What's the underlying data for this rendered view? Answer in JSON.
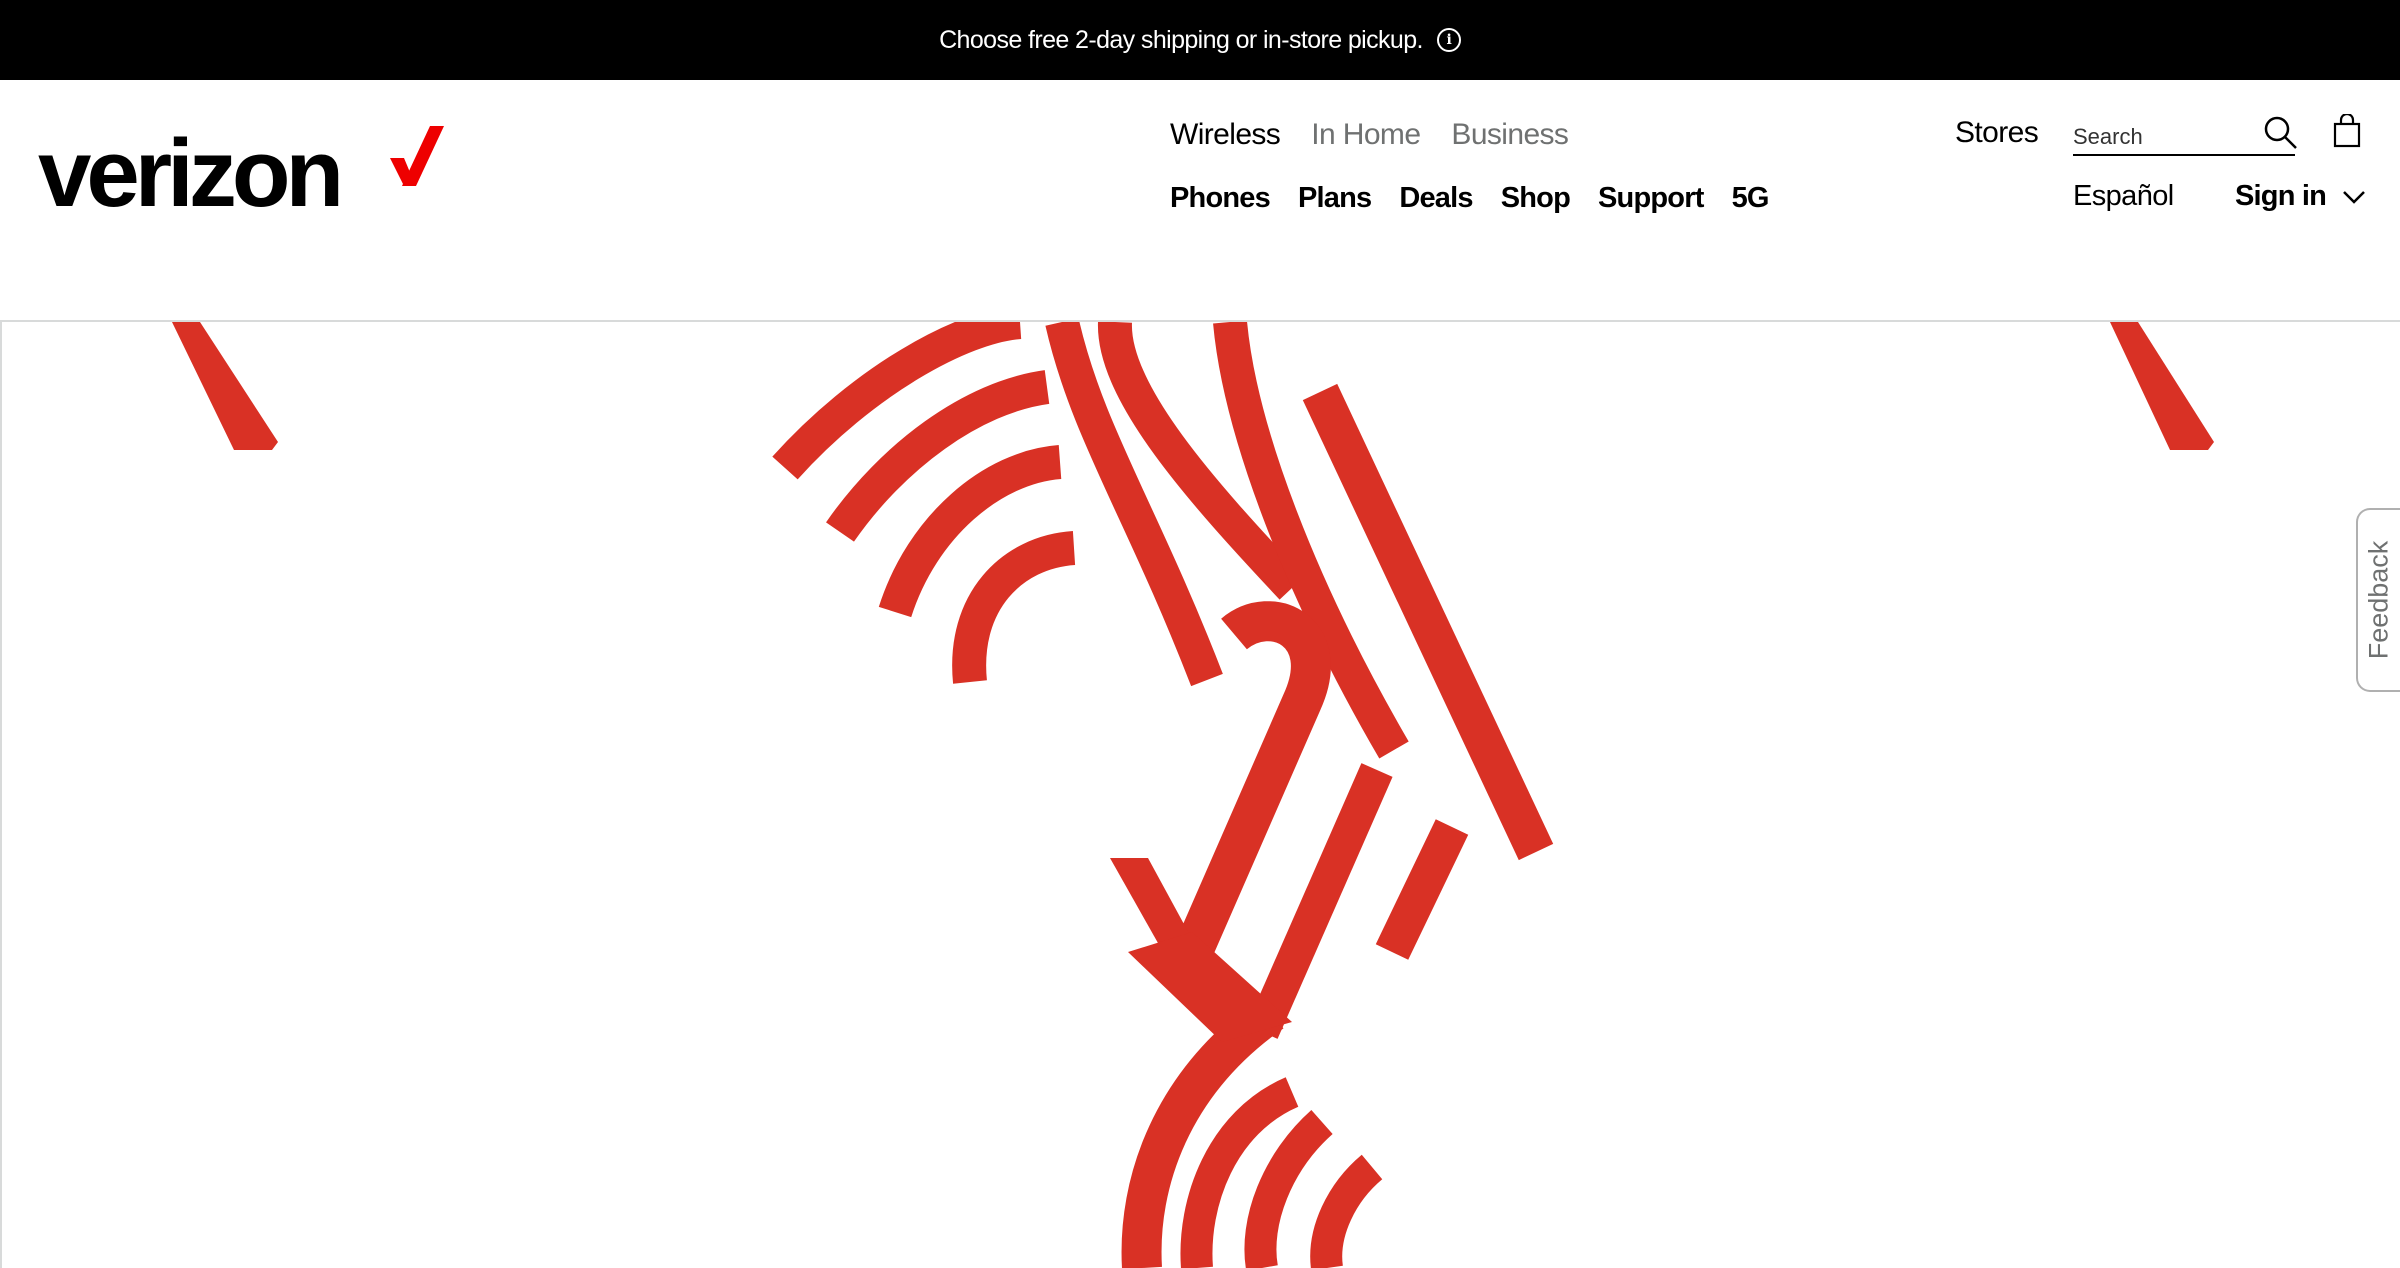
{
  "promo": {
    "text": "Choose free 2-day shipping or in-store pickup.",
    "icon": "info-icon"
  },
  "header": {
    "logo_text": "verizon",
    "brand_color": "#ee0000",
    "nav_top": [
      "Wireless",
      "In Home",
      "Business"
    ],
    "nav_main": [
      "Phones",
      "Plans",
      "Deals",
      "Shop",
      "Support",
      "5G"
    ],
    "stores_label": "Stores",
    "search": {
      "placeholder": "Search",
      "icon": "search-icon"
    },
    "cart_icon": "shopping-bag-icon",
    "language_label": "Español",
    "signin_label": "Sign in",
    "signin_icon": "chevron-down-icon"
  },
  "hero": {
    "graphic_color": "#d93125"
  },
  "feedback": {
    "label": "Feedback"
  }
}
